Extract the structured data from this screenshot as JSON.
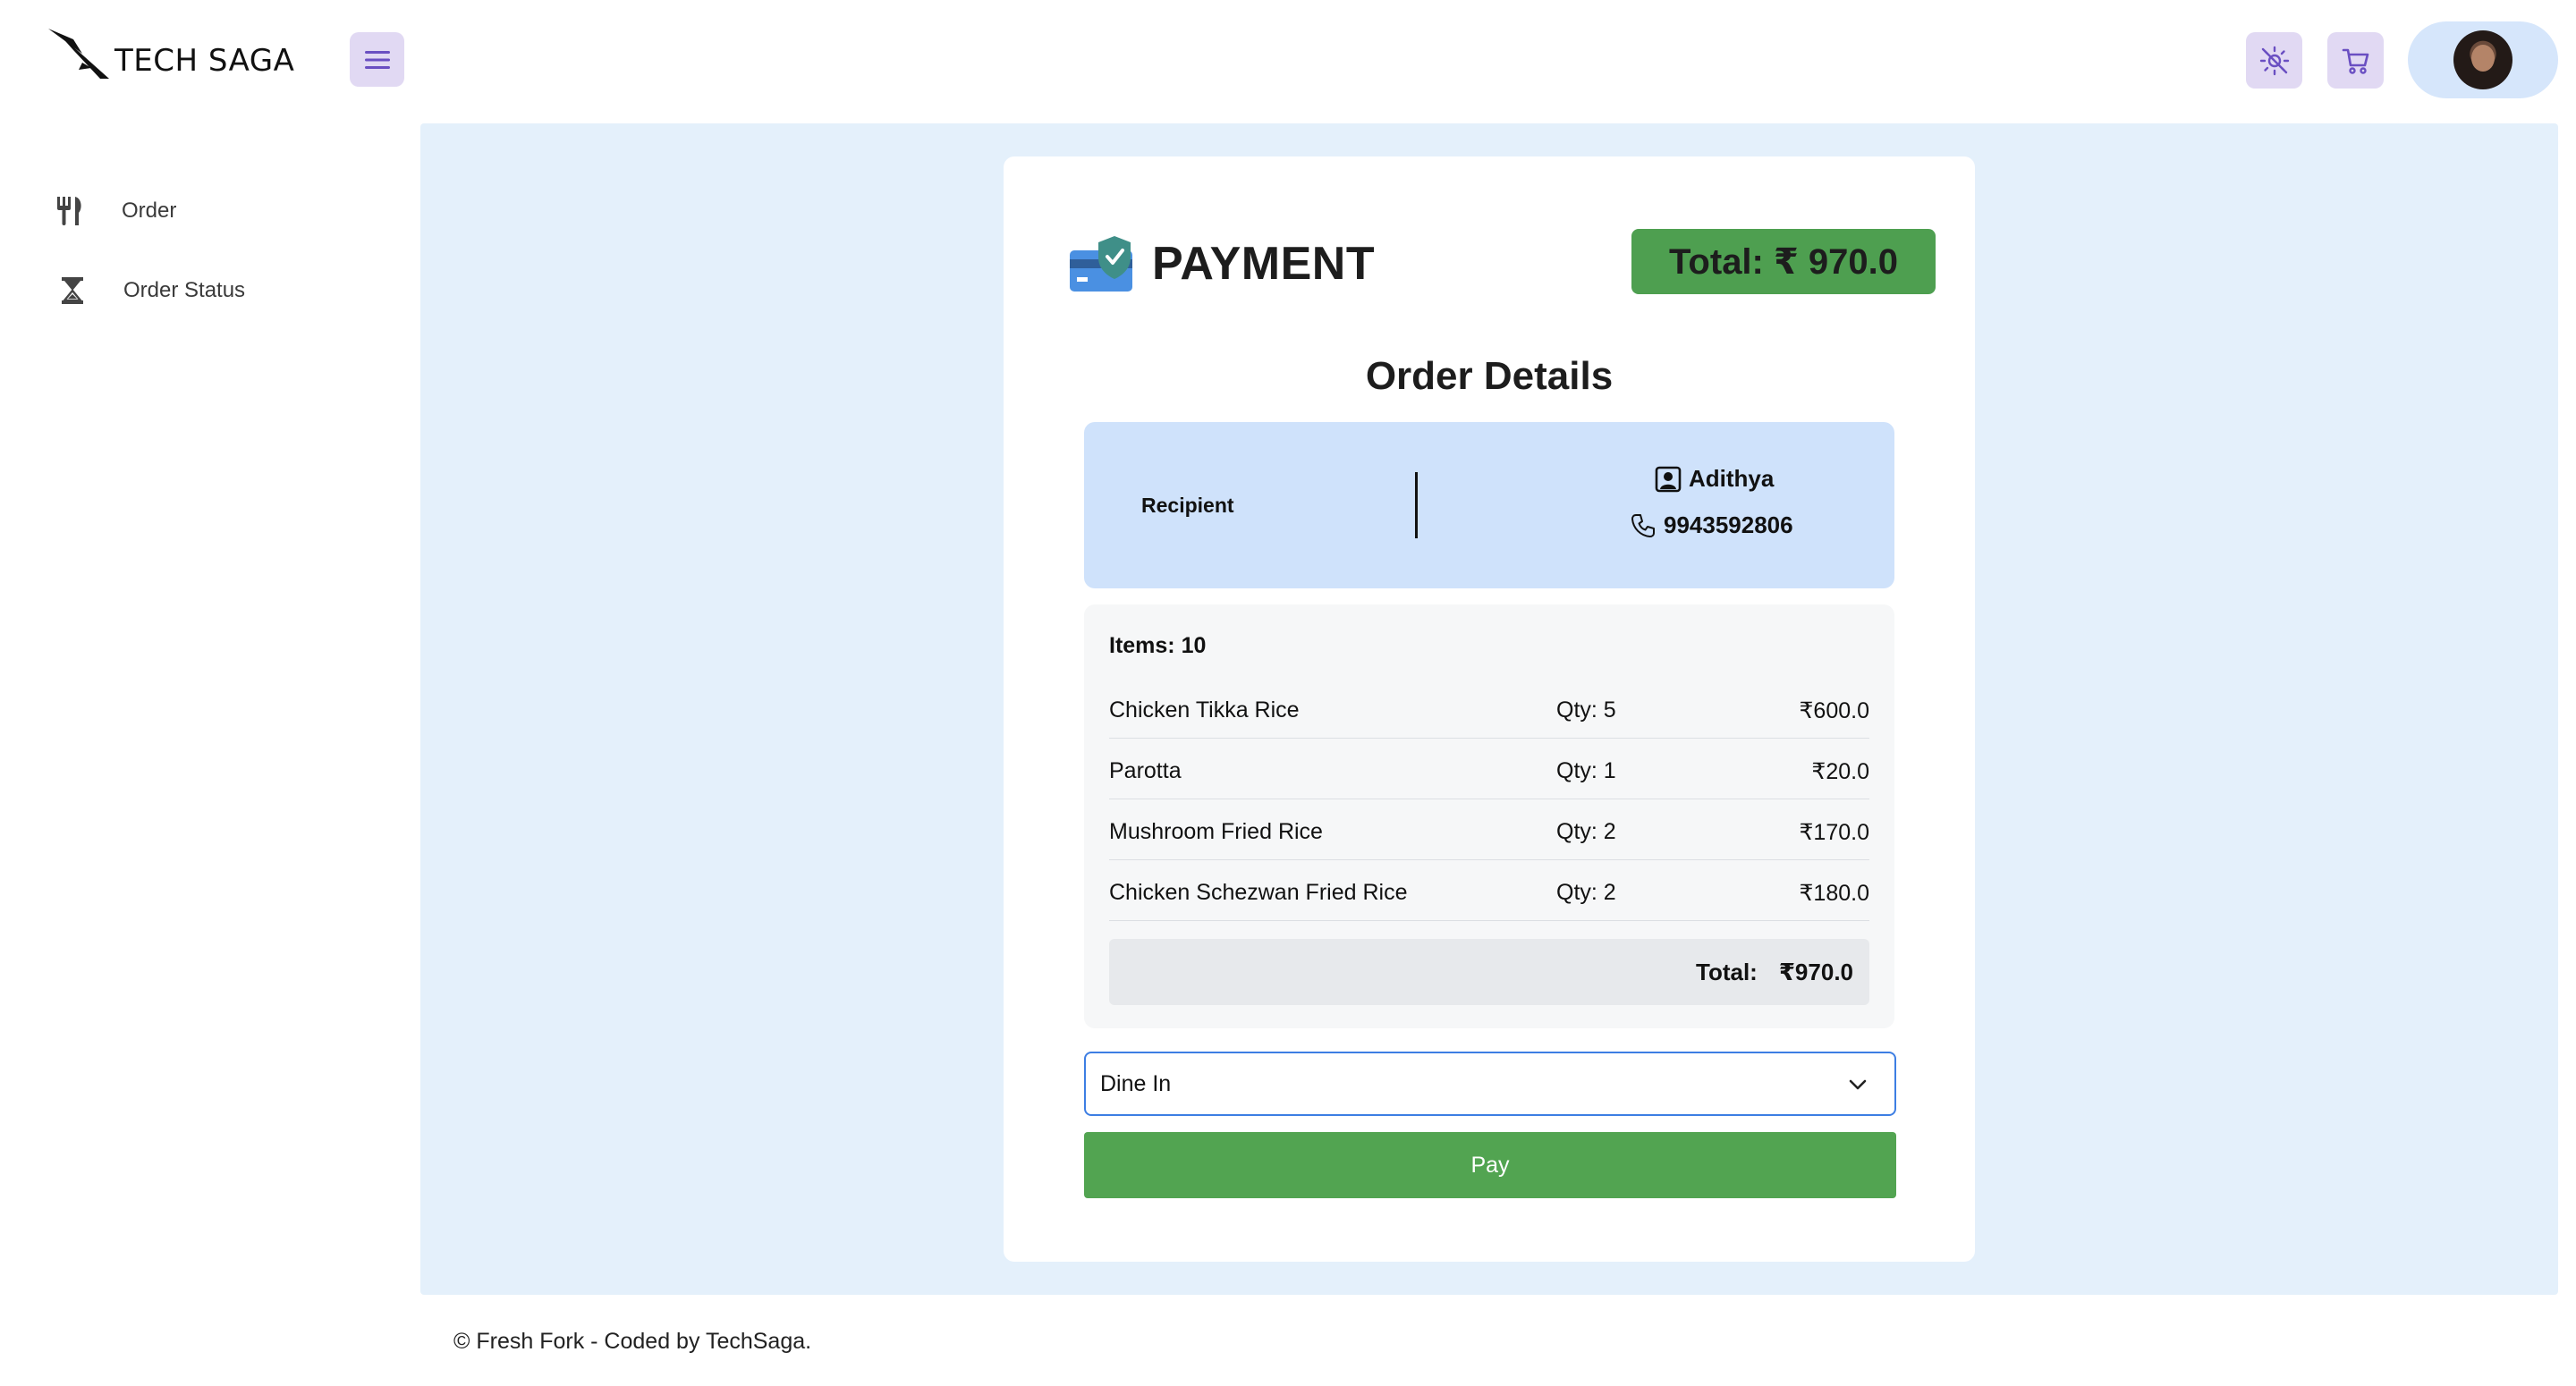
{
  "header": {
    "brand": "TECH SAGA",
    "menu_icon": "hamburger-menu-icon",
    "theme_icon": "brightness-icon",
    "cart_icon": "cart-icon"
  },
  "sidebar": {
    "items": [
      {
        "label": "Order",
        "icon": "fork-knife-icon"
      },
      {
        "label": "Order Status",
        "icon": "hourglass-icon"
      }
    ]
  },
  "payment": {
    "title": "PAYMENT",
    "total_badge": "Total: ₹ 970.0",
    "order_heading": "Order Details",
    "recipient": {
      "label": "Recipient",
      "name": "Adithya",
      "phone": "9943592806"
    },
    "items_count": "Items: 10",
    "items": [
      {
        "name": "Chicken Tikka Rice",
        "qty": "Qty: 5",
        "price": "₹600.0"
      },
      {
        "name": "Parotta",
        "qty": "Qty: 1",
        "price": "₹20.0"
      },
      {
        "name": "Mushroom Fried Rice",
        "qty": "Qty: 2",
        "price": "₹170.0"
      },
      {
        "name": "Chicken Schezwan Fried Rice",
        "qty": "Qty: 2",
        "price": "₹180.0"
      }
    ],
    "total_label": "Total:",
    "total_value": "₹970.0",
    "order_type_selected": "Dine In",
    "pay_label": "Pay"
  },
  "footer": {
    "text": "© Fresh Fork - Coded by TechSaga."
  },
  "colors": {
    "accent_purple": "#e1d9f3",
    "panel_bg": "#e4f0fb",
    "recipient_bg": "#cfe2fb",
    "green": "#52a451",
    "select_border": "#3d7ee3"
  }
}
